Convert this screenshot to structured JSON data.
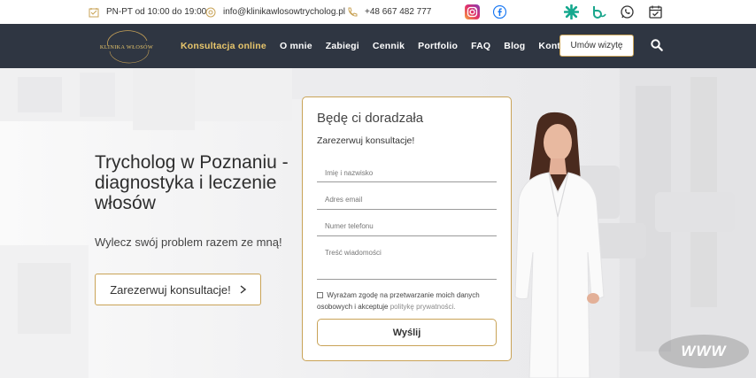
{
  "topbar": {
    "hours": "PN-PT od 10:00 do 19:00",
    "email": "info@klinikawlosowtrycholog.pl",
    "phone": "+48 667 482 777",
    "social": [
      {
        "icon": "instagram-icon",
        "color": "#d6297c"
      },
      {
        "icon": "facebook-icon",
        "color": "#1877f2"
      },
      {
        "icon": "znanylekarz-icon",
        "color": "#15a88e"
      },
      {
        "icon": "booksy-icon",
        "color": "#1aa68c"
      },
      {
        "icon": "whatsapp-icon",
        "color": "#333333"
      },
      {
        "icon": "calendar-check-icon",
        "color": "#333333"
      }
    ]
  },
  "logo": {
    "text": "KLINIKA WŁOSÓW"
  },
  "nav": {
    "items": [
      "Konsultacja online",
      "O mnie",
      "Zabiegi",
      "Cennik",
      "Portfolio",
      "FAQ",
      "Blog",
      "Kontakt"
    ],
    "book_button": "Umów wizytę"
  },
  "hero": {
    "title": "Trycholog w Poznaniu - diagnostyka i leczenie włosów",
    "subtitle": "Wylecz swój problem razem ze mną!",
    "cta": "Zarezerwuj konsultacje!"
  },
  "form": {
    "title": "Będę ci doradzała",
    "subtitle": "Zarezerwuj konsultacje!",
    "name_placeholder": "Imię i nazwisko",
    "email_placeholder": "Adres email",
    "phone_placeholder": "Numer telefonu",
    "message_placeholder": "Treść wiadomości",
    "consent_text": "Wyrażam zgodę na przetwarzanie moich danych osobowych i akceptuje",
    "consent_link": "politykę prywatności.",
    "submit": "Wyślij"
  },
  "badge": {
    "text": "WWW"
  },
  "colors": {
    "accent": "#c9a357",
    "nav_bg": "#2f3642",
    "active_nav": "#e8c66c"
  }
}
